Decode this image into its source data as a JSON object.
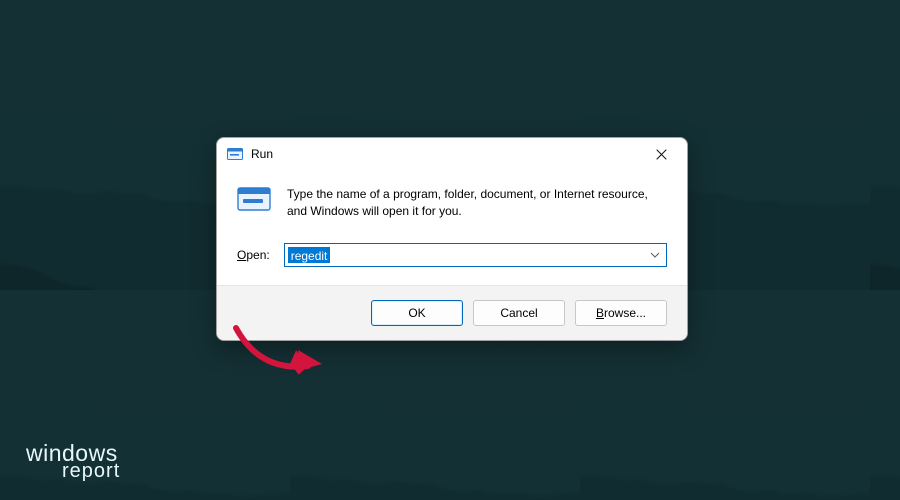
{
  "dialog": {
    "title": "Run",
    "description": "Type the name of a program, folder, document, or Internet resource, and Windows will open it for you.",
    "open_label_pre": "O",
    "open_label_post": "pen:",
    "input_value": "regedit",
    "buttons": {
      "ok": "OK",
      "cancel": "Cancel",
      "browse_pre": "B",
      "browse_post": "rowse..."
    }
  },
  "watermark": {
    "line1": "windows",
    "line2": "report"
  }
}
